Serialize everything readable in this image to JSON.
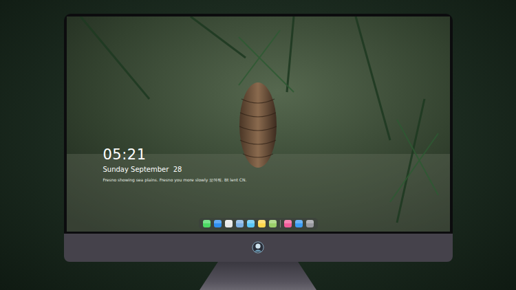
{
  "lock_screen": {
    "time": "05:21",
    "date": "Sunday September  28",
    "caption": "Fresno showing sea plains. Fresno you more slowly 보여줘. Bt lent CN."
  },
  "dock": {
    "items": [
      {
        "kind": "app",
        "color": "#4cd964"
      },
      {
        "kind": "app",
        "color": "#2f8ff0"
      },
      {
        "kind": "app",
        "color": "#e8e8e8"
      },
      {
        "kind": "app",
        "color": "#7fb2e5"
      },
      {
        "kind": "app",
        "color": "#5ac8fa"
      },
      {
        "kind": "app",
        "color": "#ffd84d"
      },
      {
        "kind": "app",
        "color": "#9bcf6a"
      },
      {
        "kind": "separator"
      },
      {
        "kind": "app",
        "color": "#f25c9a"
      },
      {
        "kind": "app",
        "color": "#3b9cf5"
      },
      {
        "kind": "app",
        "color": "#9a9aa0"
      }
    ]
  }
}
